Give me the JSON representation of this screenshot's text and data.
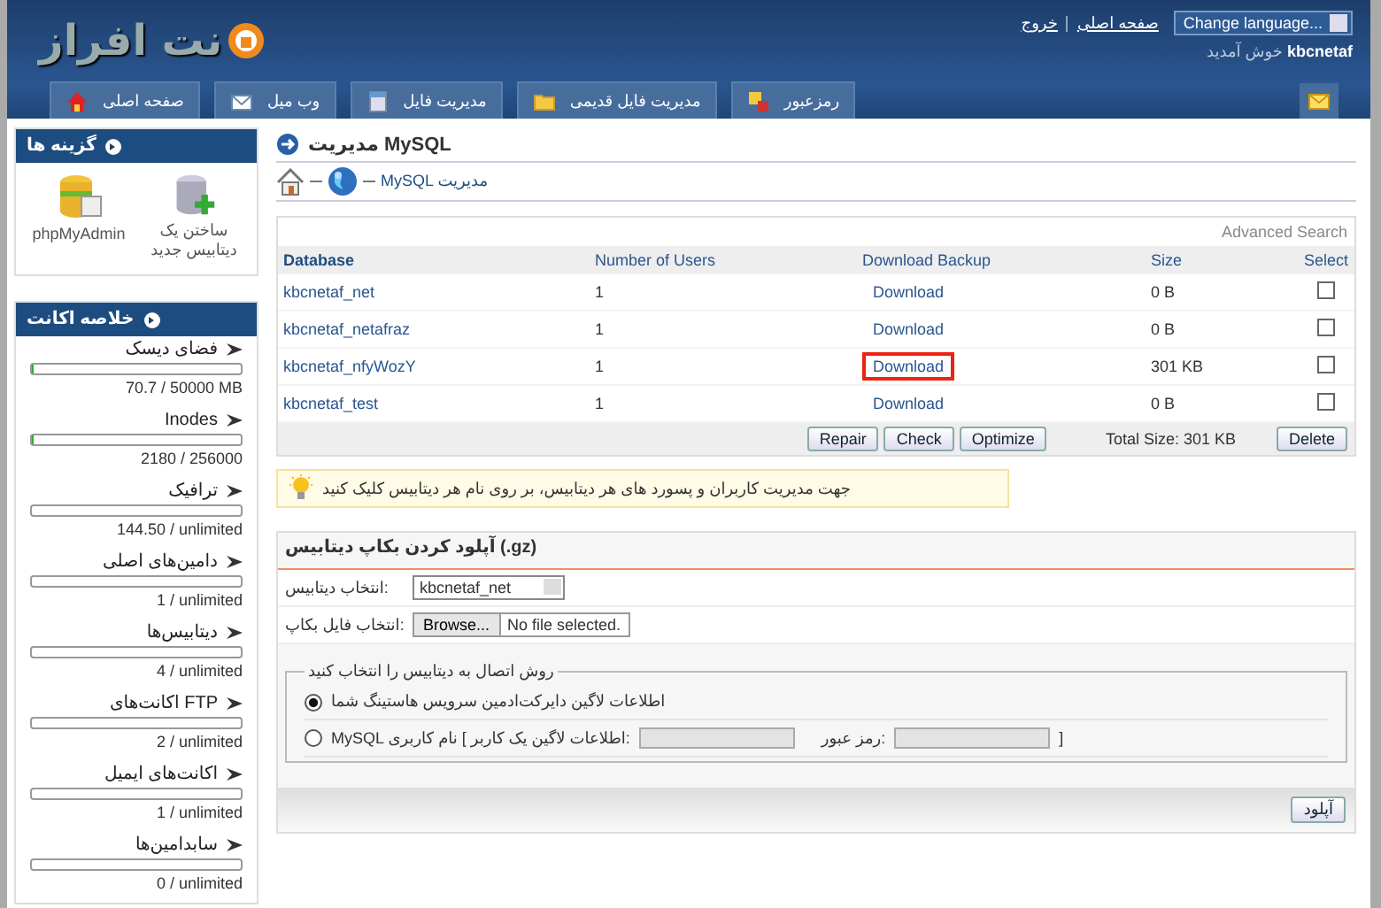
{
  "header": {
    "logo": "نت افراز",
    "language": "Change language...",
    "links": [
      "صفحه اصلی",
      "خروج"
    ],
    "welcome_user": "kbcnetaf",
    "welcome": "خوش آمدید"
  },
  "nav": [
    {
      "label": "رمزعبور",
      "kind": "lock"
    },
    {
      "label": "مدیریت فایل قدیمی",
      "kind": "folder"
    },
    {
      "label": "مدیریت فایل",
      "kind": "files"
    },
    {
      "label": "وب میل",
      "kind": "mail"
    },
    {
      "label": "صفحه اصلی",
      "kind": "home"
    }
  ],
  "shortcuts": {
    "title": "گزینه ها",
    "items": [
      {
        "label": "ساختن یک دیتابیس جدید",
        "kind": "add"
      },
      {
        "label": "phpMyAdmin",
        "kind": "pma"
      }
    ]
  },
  "summary": {
    "title": "خلاصه اکانت",
    "items": [
      {
        "label": "فضای دیسک",
        "level": 0.002,
        "value": "70.7 / 50000 MB"
      },
      {
        "label": "Inodes",
        "level": 0.01,
        "value": "2180 / 256000"
      },
      {
        "label": "ترافیک",
        "level": 0,
        "value": "144.50 / unlimited"
      },
      {
        "label": "دامین‌های اصلی",
        "level": 0,
        "value": "1 / unlimited"
      },
      {
        "label": "دیتابیس‌ها",
        "level": 0,
        "value": "4 / unlimited"
      },
      {
        "label": "اکانت‌های FTP",
        "level": 0,
        "value": "2 / unlimited"
      },
      {
        "label": "اکانت‌های ایمیل",
        "level": 0,
        "value": "1 / unlimited"
      },
      {
        "label": "سابدامین‌ها",
        "level": 0,
        "value": "0 / unlimited"
      }
    ]
  },
  "page_title": "مدیریت MySQL",
  "breadcrumb": "MySQL مدیریت",
  "table": {
    "advanced_search": "Advanced Search",
    "headers": {
      "database": "Database",
      "users": "Number of Users",
      "download": "Download Backup",
      "size": "Size",
      "select": "Select"
    },
    "rows": [
      {
        "database": "kbcnetaf_net",
        "users": "1",
        "download": "Download",
        "size": "0 B",
        "checked": false,
        "highlighted": false
      },
      {
        "database": "kbcnetaf_netafraz",
        "users": "1",
        "download": "Download",
        "size": "0 B",
        "checked": false,
        "highlighted": false
      },
      {
        "database": "kbcnetaf_nfyWozY",
        "users": "1",
        "download": "Download",
        "size": "301 KB",
        "checked": false,
        "highlighted": true
      },
      {
        "database": "kbcnetaf_test",
        "users": "1",
        "download": "Download",
        "size": "0 B",
        "checked": false,
        "highlighted": false
      }
    ],
    "repair": "Repair",
    "check": "Check",
    "optimize": "Optimize",
    "total": "Total Size: 301 KB",
    "delete": "Delete"
  },
  "tip": "جهت مدیریت کاربران و پسورد های هر دیتابیس، بر روی نام هر دیتابیس کلیک کنید",
  "upload": {
    "title": "آپلود کردن بکاپ دیتابیس (.gz)",
    "db_label": "انتخاب دیتابیس:",
    "db_value": "kbcnetaf_net",
    "file_label": "انتخاب فایل بکاپ:",
    "browse": "Browse...",
    "file_value": "No file selected.",
    "method_title": "روش اتصال به دیتابیس را انتخاب کنید",
    "options": [
      {
        "label": "اطلاعات لاگین دایرکت‌ادمین سرویس هاستینگ شما",
        "selected": true,
        "kind": "plain"
      },
      {
        "label": "MySQL اطلاعات لاگین یک کاربر ] نام کاربری:",
        "password_label": "رمز عبور:",
        "close": "]",
        "selected": false,
        "kind": "credentials"
      }
    ],
    "submit": "آپلود"
  }
}
